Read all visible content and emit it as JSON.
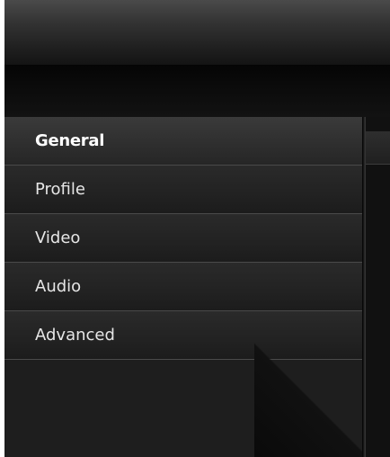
{
  "sidebar": {
    "items": [
      {
        "label": "General",
        "active": true
      },
      {
        "label": "Profile",
        "active": false
      },
      {
        "label": "Video",
        "active": false
      },
      {
        "label": "Audio",
        "active": false
      },
      {
        "label": "Advanced",
        "active": false
      }
    ]
  },
  "colors": {
    "sidebar_bg": "#1e1e1e",
    "active_item_bg": "#2f2f2f",
    "item_divider": "#4a4a4a",
    "text": "#e6e6e6"
  }
}
